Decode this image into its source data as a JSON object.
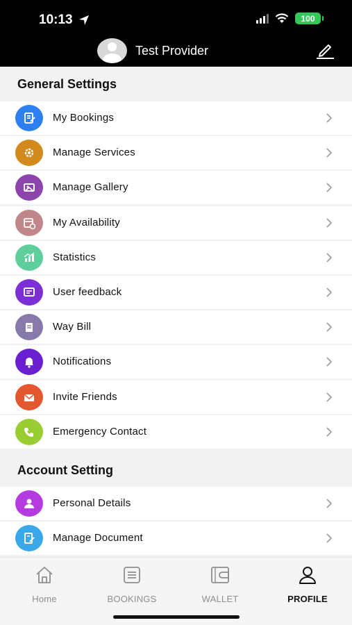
{
  "status": {
    "time": "10:13",
    "battery": "100"
  },
  "header": {
    "user_name": "Test Provider"
  },
  "general_settings": {
    "title": "General Settings",
    "items": [
      {
        "label": "My Bookings",
        "icon": "bookings-icon",
        "color": "#2e7ff0"
      },
      {
        "label": "Manage Services",
        "icon": "services-gear-icon",
        "color": "#d18a1b"
      },
      {
        "label": "Manage Gallery",
        "icon": "gallery-icon",
        "color": "#8e44ad"
      },
      {
        "label": "My Availability",
        "icon": "calendar-clock-icon",
        "color": "#c0878b"
      },
      {
        "label": "Statistics",
        "icon": "chart-icon",
        "color": "#5ecf9b"
      },
      {
        "label": "User feedback",
        "icon": "feedback-icon",
        "color": "#7b2fd4"
      },
      {
        "label": "Way Bill",
        "icon": "waybill-icon",
        "color": "#8779aa"
      },
      {
        "label": "Notifications",
        "icon": "bell-icon",
        "color": "#6a1fd0"
      },
      {
        "label": "Invite Friends",
        "icon": "envelope-icon",
        "color": "#e5572e"
      },
      {
        "label": "Emergency Contact",
        "icon": "phone-icon",
        "color": "#9acd32"
      }
    ]
  },
  "account_setting": {
    "title": "Account Setting",
    "items": [
      {
        "label": "Personal Details",
        "icon": "person-icon",
        "color": "#b43be0"
      },
      {
        "label": "Manage Document",
        "icon": "document-edit-icon",
        "color": "#38a8e8"
      }
    ]
  },
  "tabs": [
    {
      "label": "Home",
      "icon": "home-icon",
      "active": false
    },
    {
      "label": "BOOKINGS",
      "icon": "list-icon",
      "active": false
    },
    {
      "label": "WALLET",
      "icon": "wallet-icon",
      "active": false
    },
    {
      "label": "PROFILE",
      "icon": "profile-icon",
      "active": true
    }
  ]
}
